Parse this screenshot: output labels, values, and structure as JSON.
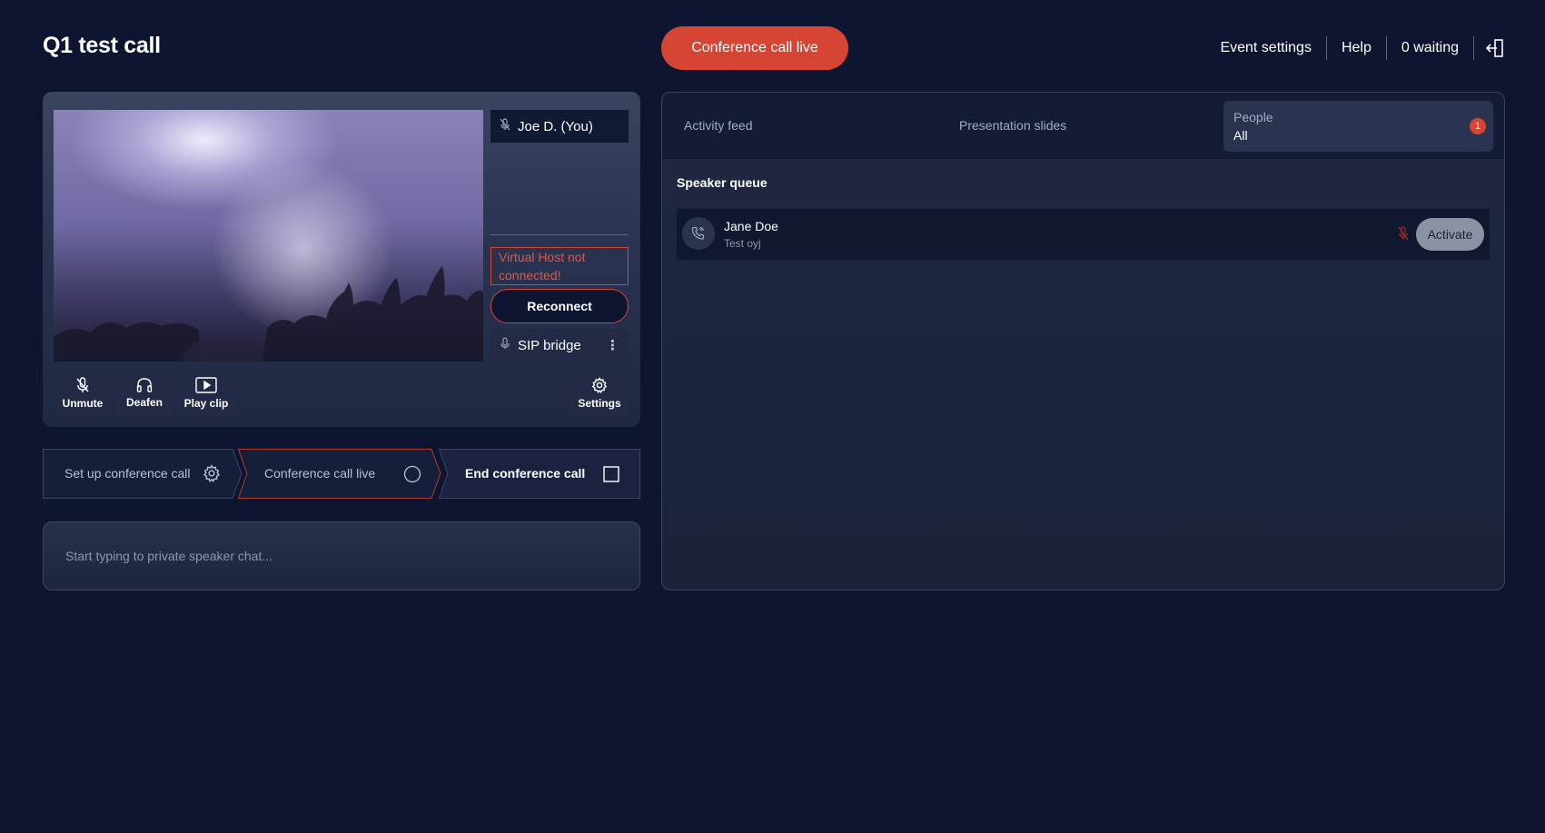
{
  "header": {
    "title": "Q1 test call",
    "live_button": "Conference call live",
    "nav": [
      "Event settings",
      "Help",
      "0 waiting"
    ],
    "exit_icon": "exit-door-icon"
  },
  "stage": {
    "self_label": "Joe D. (You)",
    "virtual_host_warning": "Virtual Host not connected!",
    "reconnect_label": "Reconnect",
    "sip_label": "SIP bridge",
    "controls": {
      "unmute": "Unmute",
      "deafen": "Deafen",
      "play_clip": "Play clip",
      "settings": "Settings"
    }
  },
  "steps": {
    "setup": "Set up conference call",
    "live": "Conference call live",
    "end": "End conference call"
  },
  "chat": {
    "placeholder": "Start typing to private speaker chat..."
  },
  "side": {
    "tabs": {
      "activity": "Activity feed",
      "slides": "Presentation slides",
      "people_label": "People",
      "people_value": "All",
      "people_badge": "1"
    },
    "queue_title": "Speaker queue",
    "queue": [
      {
        "name": "Jane Doe",
        "subtitle": "Test oyj",
        "action": "Activate"
      }
    ]
  },
  "colors": {
    "background": "#0e1530",
    "accent": "#d64533",
    "panel": "#2a3350"
  }
}
